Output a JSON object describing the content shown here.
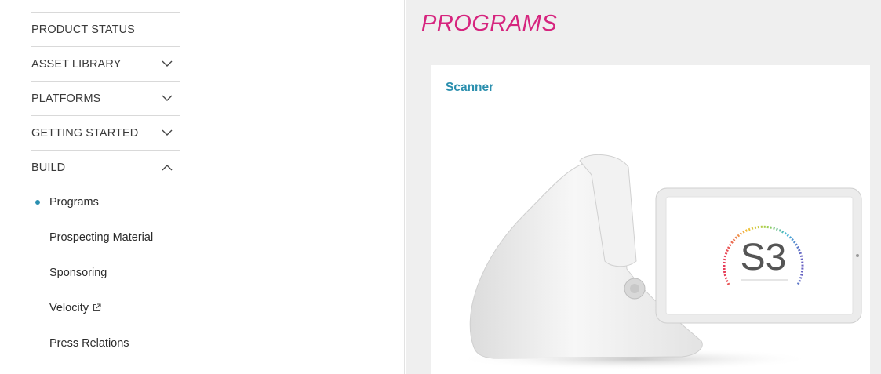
{
  "sidebar": {
    "items": [
      {
        "label": "PRODUCT STATUS",
        "chevron": "none"
      },
      {
        "label": "ASSET LIBRARY",
        "chevron": "chevron-down-icon"
      },
      {
        "label": "PLATFORMS",
        "chevron": "chevron-down-icon"
      },
      {
        "label": "GETTING STARTED",
        "chevron": "chevron-down-icon"
      },
      {
        "label": "BUILD",
        "chevron": "chevron-up-icon"
      }
    ],
    "build_subitems": [
      {
        "label": "Programs",
        "active": true
      },
      {
        "label": "Prospecting Material"
      },
      {
        "label": "Sponsoring"
      },
      {
        "label": "Velocity",
        "icon": "external-link-icon"
      },
      {
        "label": "Press Relations"
      }
    ]
  },
  "main": {
    "title": "PROGRAMS",
    "card": {
      "title": "Scanner",
      "image_text": "S3"
    }
  },
  "colors": {
    "title_accent": "#d6247e",
    "link_accent": "#2b8fae",
    "active_dot": "#2a8fb0",
    "main_bg": "#efefef"
  }
}
